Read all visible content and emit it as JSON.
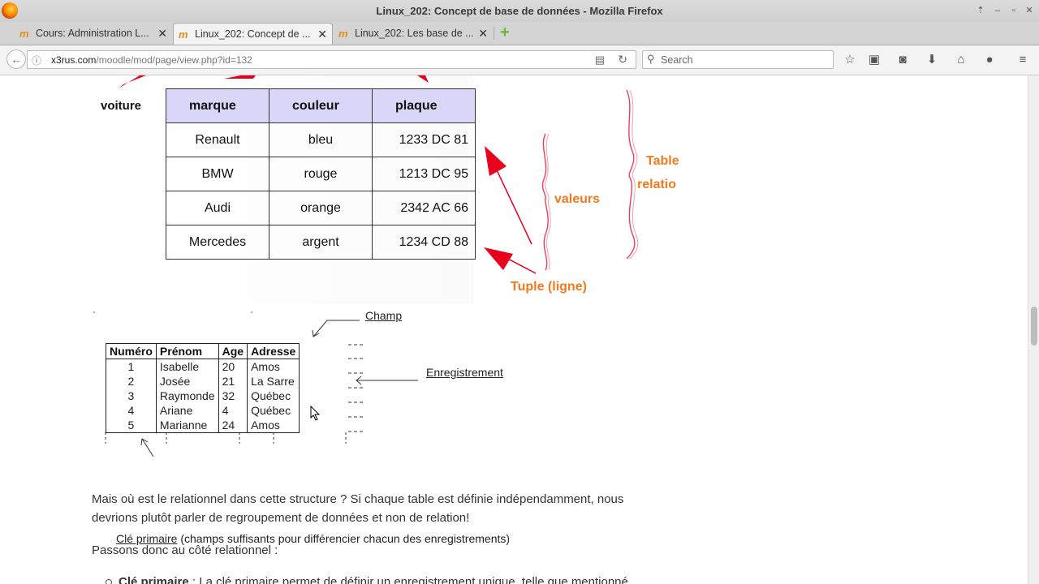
{
  "window": {
    "title": "Linux_202: Concept de base de données - Mozilla Firefox",
    "controls": {
      "up": "⇡",
      "minimize": "–",
      "maximize": "▫",
      "close": "✕"
    }
  },
  "tabs": [
    {
      "label": "Cours: Administration L...",
      "close": "✕"
    },
    {
      "label": "Linux_202: Concept de ...",
      "close": "✕"
    },
    {
      "label": "Linux_202: Les base de ...",
      "close": "✕"
    }
  ],
  "tab_icon": "m",
  "newtab_label": "+",
  "nav": {
    "back": "←",
    "url_domain": "x3rus.com",
    "url_path": "/moodle/mod/page/view.php?id=132",
    "search_placeholder": "Search"
  },
  "figure1": {
    "row_label": "voiture",
    "headers": [
      "marque",
      "couleur",
      "plaque"
    ],
    "rows": [
      [
        "Renault",
        "bleu",
        "1233 DC 81"
      ],
      [
        "BMW",
        "rouge",
        "1213 DC 95"
      ],
      [
        "Audi",
        "orange",
        "2342 AC 66"
      ],
      [
        "Mercedes",
        "argent",
        "1234 CD 88"
      ]
    ],
    "label_valeurs": "valeurs",
    "label_table1": "Table",
    "label_table2": "relatio",
    "label_tuple": "Tuple (ligne)",
    "accent_color": "#f07a1d",
    "arrow_color": "#e8001c"
  },
  "figure2": {
    "headers": [
      "Numéro",
      "Prénom",
      "Age",
      "Adresse"
    ],
    "rows": [
      [
        "1",
        "Isabelle",
        "20",
        "Amos"
      ],
      [
        "2",
        "Josée",
        "21",
        "La Sarre"
      ],
      [
        "3",
        "Raymonde",
        "32",
        "Québec"
      ],
      [
        "4",
        "Ariane",
        "4",
        "Québec"
      ],
      [
        "5",
        "Marianne",
        "24",
        "Amos"
      ]
    ],
    "champ_label": "Champ",
    "enreg_label": "Enregistrement",
    "cle_label": "Clé primaire",
    "cle_desc": " (champs suffisants pour différencier chacun des enregistrements)"
  },
  "paragraphs": {
    "p1": "Mais où est le relationnel dans cette structure ? Si chaque table est définie indépendamment, nous devrions plutôt parler de regroupement de données et non de relation!",
    "p2": "Passons donc au côté relationnel :",
    "bullet_bold": "Clé primaire",
    "bullet_rest": " : La clé primaire permet de définir un enregistrement unique, telle que mentionné"
  }
}
